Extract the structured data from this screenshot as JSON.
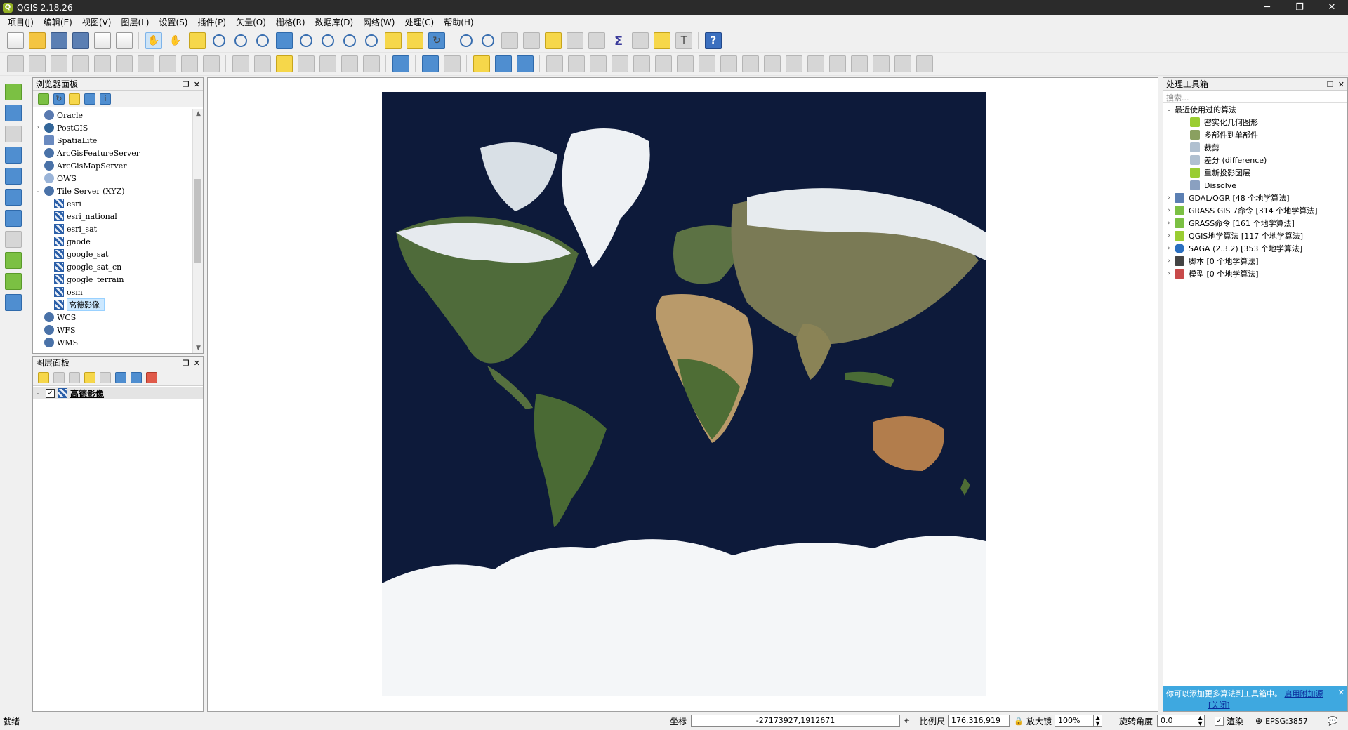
{
  "window": {
    "title": "QGIS 2.18.26",
    "minimize": "─",
    "maximize": "❐",
    "close": "✕"
  },
  "menu": [
    "项目(J)",
    "编辑(E)",
    "视图(V)",
    "图层(L)",
    "设置(S)",
    "插件(P)",
    "矢量(O)",
    "栅格(R)",
    "数据库(D)",
    "网络(W)",
    "处理(C)",
    "帮助(H)"
  ],
  "browser_panel": {
    "title": "浏览器面板",
    "items": [
      {
        "label": "Oracle",
        "icon": "database-icon",
        "expand": ""
      },
      {
        "label": "PostGIS",
        "icon": "elephant-icon",
        "expand": "›"
      },
      {
        "label": "SpatiaLite",
        "icon": "feather-icon",
        "expand": ""
      },
      {
        "label": "ArcGisFeatureServer",
        "icon": "globe-icon",
        "expand": ""
      },
      {
        "label": "ArcGisMapServer",
        "icon": "globe-icon",
        "expand": ""
      },
      {
        "label": "OWS",
        "icon": "globe-icon",
        "expand": ""
      },
      {
        "label": "Tile Server (XYZ)",
        "icon": "globe-icon",
        "expand": "⌄"
      }
    ],
    "xyz_children": [
      "esri",
      "esri_national",
      "esri_sat",
      "gaode",
      "google_sat",
      "google_sat_cn",
      "google_terrain",
      "osm",
      "高德影像"
    ],
    "trailing_items": [
      {
        "label": "WCS",
        "icon": "globe-icon"
      },
      {
        "label": "WFS",
        "icon": "globe-icon"
      },
      {
        "label": "WMS",
        "icon": "globe-icon"
      }
    ]
  },
  "layers_panel": {
    "title": "图层面板",
    "layers": [
      {
        "label": "高德影像",
        "checked": "✓"
      }
    ]
  },
  "processing_panel": {
    "title": "处理工具箱",
    "search_placeholder": "搜索...",
    "recent_group": "最近使用过的算法",
    "recent": [
      "密实化几何图形",
      "多部件到单部件",
      "裁剪",
      "差分 (difference)",
      "重新投影图层",
      "Dissolve"
    ],
    "providers": [
      "GDAL/OGR [48 个地学算法]",
      "GRASS GIS 7命令 [314 个地学算法]",
      "GRASS命令 [161 个地学算法]",
      "QGIS地学算法 [117 个地学算法]",
      "SAGA (2.3.2) [353 个地学算法]",
      "脚本 [0 个地学算法]",
      "模型 [0 个地学算法]"
    ],
    "notice_text": "你可以添加更多算法到工具箱中。",
    "notice_link1": "启用附加源",
    "notice_link2": "[关闭]",
    "notice_close": "✕"
  },
  "statusbar": {
    "ready": "就绪",
    "coord_label": "坐标",
    "coord_value": "-27173927,1912671",
    "scale_label": "比例尺",
    "scale_value": "176,316,919",
    "magnifier_label": "放大镜",
    "magnifier_value": "100%",
    "rotation_label": "旋转角度",
    "rotation_value": "0.0",
    "render_label": "渲染",
    "render_checked": "✓",
    "crs": "EPSG:3857"
  },
  "colors": {
    "accent": "#3ea8e0",
    "ocean": "#0d1a3a",
    "selection": "#cce8ff"
  }
}
